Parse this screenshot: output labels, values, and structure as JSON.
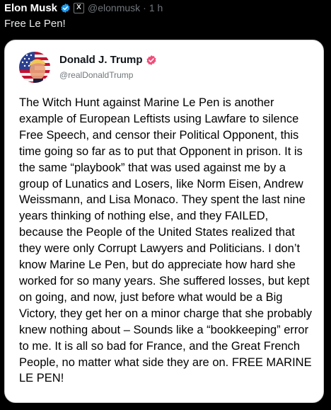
{
  "post": {
    "author_name": "Elon Musk",
    "handle": "@elonmusk",
    "separator": "·",
    "time": "1 h",
    "affiliate_badge": "X",
    "text": "Free Le Pen!",
    "verified_color": "#1d9bf0"
  },
  "quote": {
    "author_name": "Donald J. Trump",
    "handle": "@realDonaldTrump",
    "badge_color": "#ef4d78",
    "body": "The Witch Hunt against Marine Le Pen is another example of European Leftists using Lawfare to silence Free Speech, and censor their Political Opponent, this time going so far as to put that Opponent in prison. It is the same “playbook” that was used against me by a group of Lunatics and Losers, like Norm Eisen, Andrew Weissmann, and Lisa Monaco. They spent the last nine years thinking of nothing else, and they FAILED, because the People of the United States realized that they were only Corrupt Lawyers and Politicians. I don’t know Marine Le Pen, but do appreciate how hard she worked for so many years. She suffered losses, but kept on going, and now, just before what would be a Big Victory, they get her on a minor charge that she probably knew nothing about – Sounds like a “bookkeeping” error to me. It is all so bad for France, and the Great French People, no matter what side they are on. FREE MARINE LE PEN!"
  }
}
